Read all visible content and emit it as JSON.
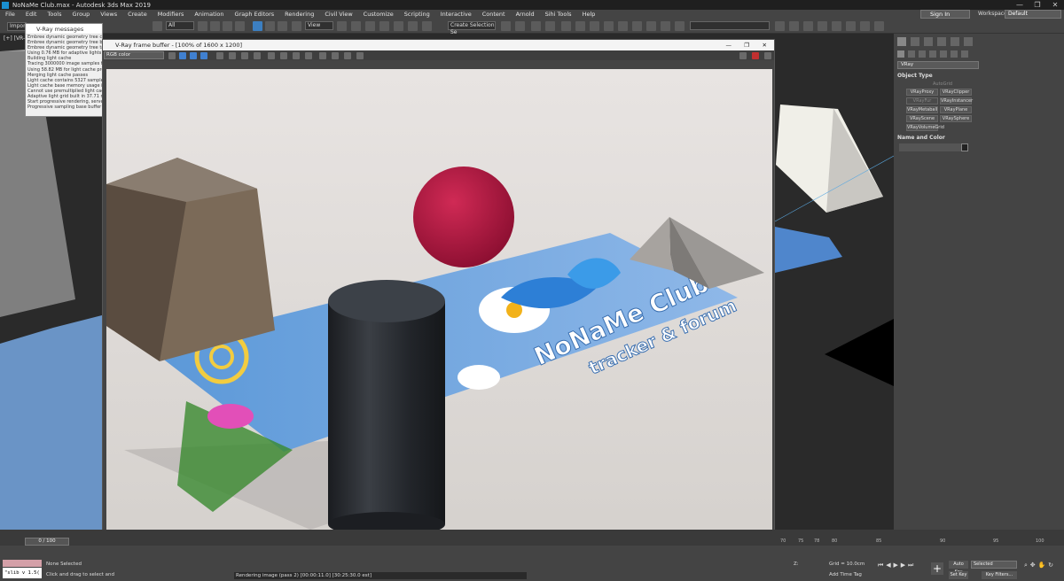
{
  "app": {
    "title": "NoNaMe Club.max - Autodesk 3ds Max 2019",
    "window_controls": [
      "—",
      "❐",
      "✕"
    ]
  },
  "menu": [
    "File",
    "Edit",
    "Tools",
    "Group",
    "Views",
    "Create",
    "Modifiers",
    "Animation",
    "Graph Editors",
    "Rendering",
    "Civil View",
    "Customize",
    "Scripting",
    "Interactive",
    "Content",
    "Arnold",
    "Sihi Tools",
    "Help"
  ],
  "account": {
    "sign_in": "Sign In",
    "workspaces_label": "Workspaces:",
    "workspace": "Default"
  },
  "toolbar": {
    "import": "Import",
    "filter": "All",
    "ref_coord": "View",
    "selection_set": "Create Selection Se"
  },
  "viewport": {
    "label": "[+] [VR-..."
  },
  "vray_messages": {
    "title": "V-Ray messages",
    "lines": [
      "Embree dynamic geometry tree contains 1 primitive",
      "Embree dynamic geometry tree built in 0.0",
      "Embree dynamic geometry tree takes 0.0",
      "Using 0.76 MB for adaptive lights buffer",
      "Building light cache",
      "Tracing 3000000 image samples for light",
      "Using 58.82 MB for light cache preview",
      "Merging light cache passes",
      "Light cache contains 5327 samples",
      "Light cache base memory usage is 0.6",
      "Cannot use premultiplied light cache b",
      "Adaptive light grid built in 37.71 ms",
      "Start progressive rendering, server load",
      "Progressive sampling base buffer mem"
    ]
  },
  "vfb": {
    "title": "V-Ray frame buffer - [100% of 1600 x 1200]",
    "channel": "RGB color",
    "controls": [
      "—",
      "❐",
      "✕"
    ]
  },
  "render": {
    "banner_line1": "NoNaMe Club",
    "banner_line2": "tracker & forum"
  },
  "command_panel": {
    "category": "VRay",
    "object_type_header": "Object Type",
    "autogrid": "AutoGrid",
    "buttons": [
      "VRayProxy",
      "VRayClipper",
      "VRayFur",
      "VRayInstancer",
      "VRayMetaball",
      "VRayPlane",
      "VRayScene",
      "VRaySphere",
      "VRayVolumeGrid"
    ],
    "name_color_header": "Name and Color"
  },
  "timeline": {
    "slider": "0 / 100",
    "ticks": [
      "70",
      "75",
      "78",
      "80",
      "85",
      "90",
      "95",
      "100"
    ]
  },
  "status": {
    "maxscript": "\"slib v 1.5(",
    "none_selected": "None Selected",
    "prompt": "Click and drag to select and",
    "render_status": "Rendering image (pass 2) [00:00:11.0] [30:25:30.0 est]",
    "z_label": "Z:",
    "grid": "Grid = 10.0cm",
    "add_time_tag": "Add Time Tag",
    "auto_key": "Auto Key",
    "set_key": "Set Key",
    "selected": "Selected",
    "key_filters": "Key Filters..."
  },
  "colors": {
    "accent": "#3c7fc1",
    "background": "#2b2b2b",
    "panel": "#444444"
  }
}
